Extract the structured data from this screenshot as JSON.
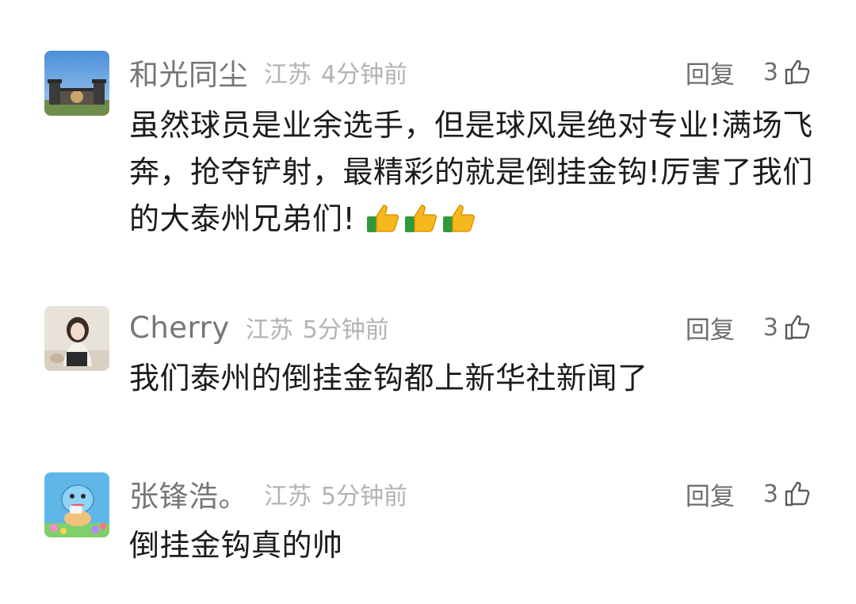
{
  "comments": [
    {
      "avatar": "gate-photo-avatar",
      "username": "和光同尘",
      "location": "江苏",
      "time": "4分钟前",
      "reply_label": "回复",
      "likes": "3",
      "content": "虽然球员是业余选手，但是球风是绝对专业!满场飞奔，抢夺铲射，最精彩的就是倒挂金钩!厉害了我们的大泰州兄弟们!",
      "emojis": [
        "thumbs-up",
        "thumbs-up",
        "thumbs-up"
      ]
    },
    {
      "avatar": "girl-photo-avatar",
      "username": "Cherry",
      "location": "江苏",
      "time": "5分钟前",
      "reply_label": "回复",
      "likes": "3",
      "content": "我们泰州的倒挂金钩都上新华社新闻了"
    },
    {
      "avatar": "cartoon-turtle-avatar",
      "username": "张锋浩。",
      "location": "江苏",
      "time": "5分钟前",
      "reply_label": "回复",
      "likes": "3",
      "content": "倒挂金钩真的帅"
    }
  ],
  "colors": {
    "username": "#767676",
    "meta": "#b3b3b3",
    "text": "#1c1c1c",
    "action": "#6e6e6e"
  },
  "icons": {
    "like": "thumbs-up-outline-icon",
    "emoji": "thumbs-up-emoji"
  }
}
